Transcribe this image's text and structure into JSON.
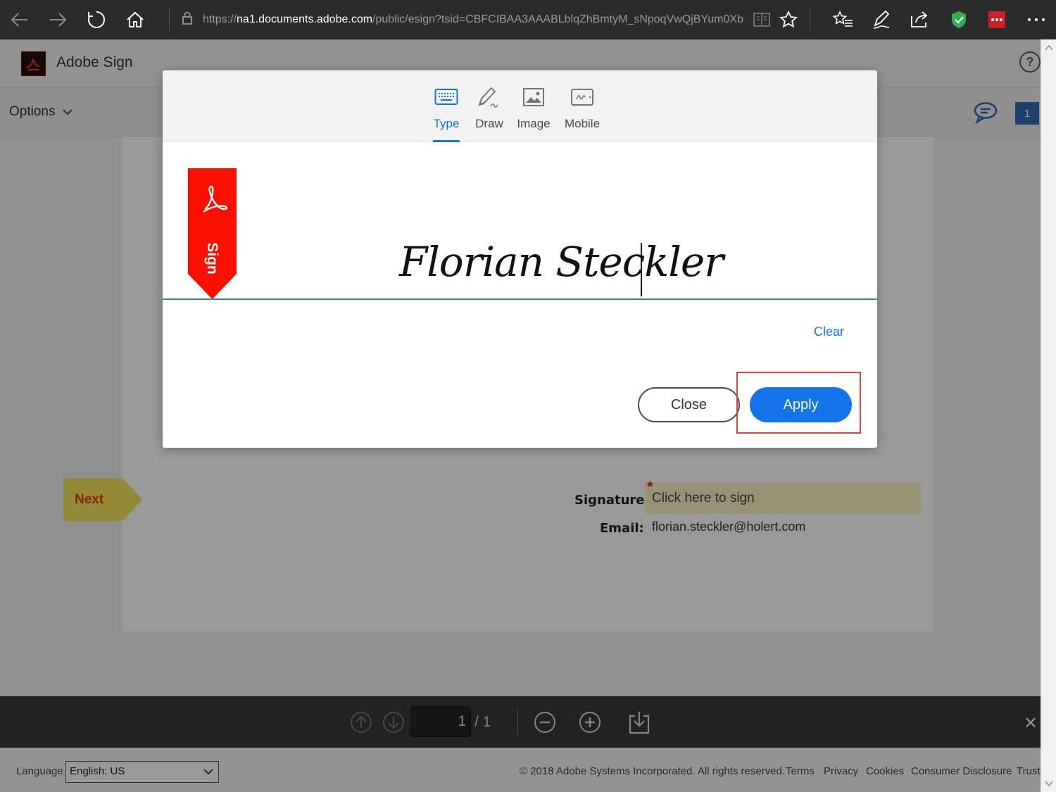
{
  "browser": {
    "url_prefix": "https://",
    "url_host": "na1.documents.adobe.com",
    "url_rest": "/public/esign?tsid=CBFCIBAA3AAABLblqZhBmtyM_sNpoqVwQjBYum0Xb",
    "icons": [
      "back-icon",
      "forward-icon",
      "refresh-icon",
      "home-icon",
      "lock-icon",
      "reading-view-icon",
      "favorite-star-icon",
      "favorites-hub-icon",
      "pen-icon",
      "share-icon",
      "shield-extension-icon",
      "password-extension-icon",
      "more-icon"
    ]
  },
  "header": {
    "app_title": "Adobe Sign",
    "help": "?"
  },
  "toolbar": {
    "options_label": "Options",
    "page_badge": "1"
  },
  "document": {
    "next_label": "Next",
    "signature_label": "Signature:",
    "signature_placeholder": "Click here to sign",
    "required_mark": "*",
    "email_label": "Email:",
    "email_value": "florian.steckler@holert.com"
  },
  "modal": {
    "tabs": [
      {
        "label": "Type",
        "active": true,
        "icon": "keyboard-icon"
      },
      {
        "label": "Draw",
        "active": false,
        "icon": "pen-draw-icon"
      },
      {
        "label": "Image",
        "active": false,
        "icon": "image-icon"
      },
      {
        "label": "Mobile",
        "active": false,
        "icon": "mobile-signature-icon"
      }
    ],
    "sign_flag_text": "Sign",
    "typed_signature": "Florian Steckler",
    "clear_label": "Clear",
    "close_label": "Close",
    "apply_label": "Apply"
  },
  "bottom_nav": {
    "current_page": "1",
    "total_pages": "/ 1"
  },
  "footer": {
    "language_label": "Language",
    "language_value": "English: US",
    "copyright": "© 2018 Adobe Systems Incorporated. All rights reserved.",
    "links": [
      "Terms",
      "Privacy",
      "Cookies",
      "Consumer Disclosure",
      "Trust"
    ]
  },
  "colors": {
    "accent": "#1473e6",
    "adobe_red": "#fa0f00",
    "highlight_box": "#d9453a",
    "field_yellow": "#fdf3c4"
  }
}
